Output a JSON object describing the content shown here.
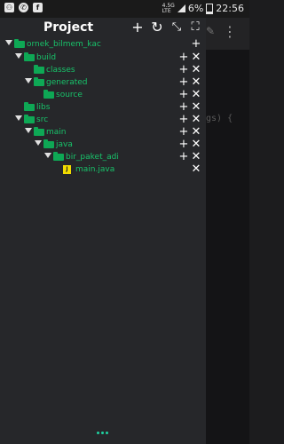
{
  "status": {
    "network": "4.5G",
    "lte": "LTE",
    "battery": "6%",
    "time": "22:56"
  },
  "panel": {
    "title": "Project",
    "toolbar": {
      "add_icon": "+",
      "refresh_icon": "↻",
      "collapse_icon": "⤡",
      "expand_icon": "⛶"
    }
  },
  "tree": [
    {
      "label": "ornek_bilmem_kac",
      "type": "folder",
      "expanded": true,
      "actions": [
        "add"
      ]
    },
    {
      "label": "build",
      "type": "folder",
      "expanded": true,
      "actions": [
        "add",
        "remove"
      ]
    },
    {
      "label": "classes",
      "type": "folder",
      "expanded": false,
      "actions": [
        "add",
        "remove"
      ]
    },
    {
      "label": "generated",
      "type": "folder",
      "expanded": true,
      "actions": [
        "add",
        "remove"
      ]
    },
    {
      "label": "source",
      "type": "folder",
      "expanded": false,
      "actions": [
        "add",
        "remove"
      ]
    },
    {
      "label": "libs",
      "type": "folder",
      "expanded": false,
      "actions": [
        "add",
        "remove"
      ]
    },
    {
      "label": "src",
      "type": "folder",
      "expanded": true,
      "actions": [
        "add",
        "remove"
      ]
    },
    {
      "label": "main",
      "type": "folder",
      "expanded": true,
      "actions": [
        "add",
        "remove"
      ]
    },
    {
      "label": "java",
      "type": "folder",
      "expanded": true,
      "actions": [
        "add",
        "remove"
      ]
    },
    {
      "label": "bir_paket_adi",
      "type": "folder",
      "expanded": true,
      "actions": [
        "add",
        "remove"
      ]
    },
    {
      "label": "main.java",
      "type": "file",
      "badge": "J",
      "actions": [
        "remove"
      ]
    }
  ],
  "editor": {
    "code_fragment": "gs) {"
  },
  "colors": {
    "folder": "#0ea855",
    "label": "#18c26a",
    "file_badge": "#f2dc00",
    "accent_dots": "#1fd1a0"
  }
}
